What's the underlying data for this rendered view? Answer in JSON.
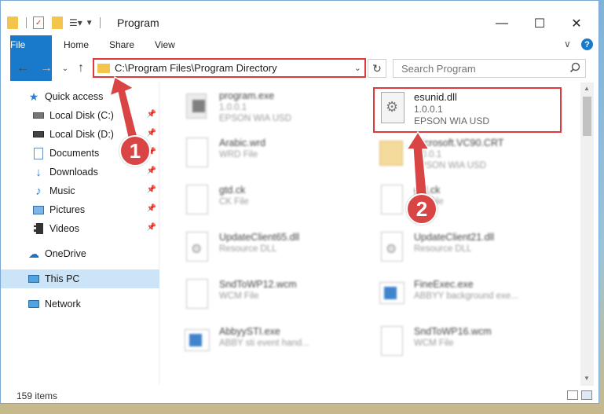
{
  "window": {
    "title": "Program",
    "controls": {
      "minimize": "—",
      "maximize": "☐",
      "close": "✕"
    }
  },
  "ribbon": {
    "tabs": [
      "File",
      "Home",
      "Share",
      "View"
    ]
  },
  "navigation": {
    "address_path": "C:\\Program Files\\Program Directory",
    "search_placeholder": "Search Program"
  },
  "sidebar": {
    "items": [
      {
        "label": "Quick access",
        "icon": "star-icon"
      },
      {
        "label": "Local Disk (C:)",
        "icon": "drive-icon",
        "pinned": true
      },
      {
        "label": "Local Disk (D:)",
        "icon": "drive-icon",
        "pinned": true
      },
      {
        "label": "Documents",
        "icon": "documents-icon",
        "pinned": true
      },
      {
        "label": "Downloads",
        "icon": "download-icon",
        "pinned": true
      },
      {
        "label": "Music",
        "icon": "music-icon",
        "pinned": true
      },
      {
        "label": "Pictures",
        "icon": "pictures-icon",
        "pinned": true
      },
      {
        "label": "Videos",
        "icon": "videos-icon",
        "pinned": true
      },
      {
        "label": "OneDrive",
        "icon": "cloud-icon"
      },
      {
        "label": "This PC",
        "icon": "computer-icon",
        "selected": true
      },
      {
        "label": "Network",
        "icon": "network-icon"
      }
    ]
  },
  "files": [
    {
      "name": "program.exe",
      "line2": "1.0.0.1",
      "line3": "EPSON WIA USD"
    },
    {
      "name": "esunid.dll",
      "line2": "1.0.0.1",
      "line3": "EPSON WIA USD",
      "highlighted": true
    },
    {
      "name": "Arabic.wrd",
      "line2": "WRD File",
      "line3": ""
    },
    {
      "name": "Microsoft.VC90.CRT",
      "line2": "1.0.0.1",
      "line3": "EPSON WIA USD"
    },
    {
      "name": "gtd.ck",
      "line2": "CK File",
      "line3": ""
    },
    {
      "name": "gtd.ck",
      "line2": "CK File",
      "line3": ""
    },
    {
      "name": "UpdateClient65.dll",
      "line2": "Resource DLL",
      "line3": ""
    },
    {
      "name": "UpdateClient21.dll",
      "line2": "Resource DLL",
      "line3": ""
    },
    {
      "name": "SndToWP12.wcm",
      "line2": "WCM File",
      "line3": ""
    },
    {
      "name": "FineExec.exe",
      "line2": "ABBYY background exe...",
      "line3": ""
    },
    {
      "name": "AbbyySTI.exe",
      "line2": "ABBY sti event hand...",
      "line3": ""
    },
    {
      "name": "SndToWP16.wcm",
      "line2": "WCM File",
      "line3": ""
    }
  ],
  "status": {
    "item_count": "159 items"
  },
  "markers": [
    "1",
    "2"
  ],
  "colors": {
    "accent": "#1979ca",
    "highlight": "#e1383b",
    "selected": "#cce4f7"
  }
}
